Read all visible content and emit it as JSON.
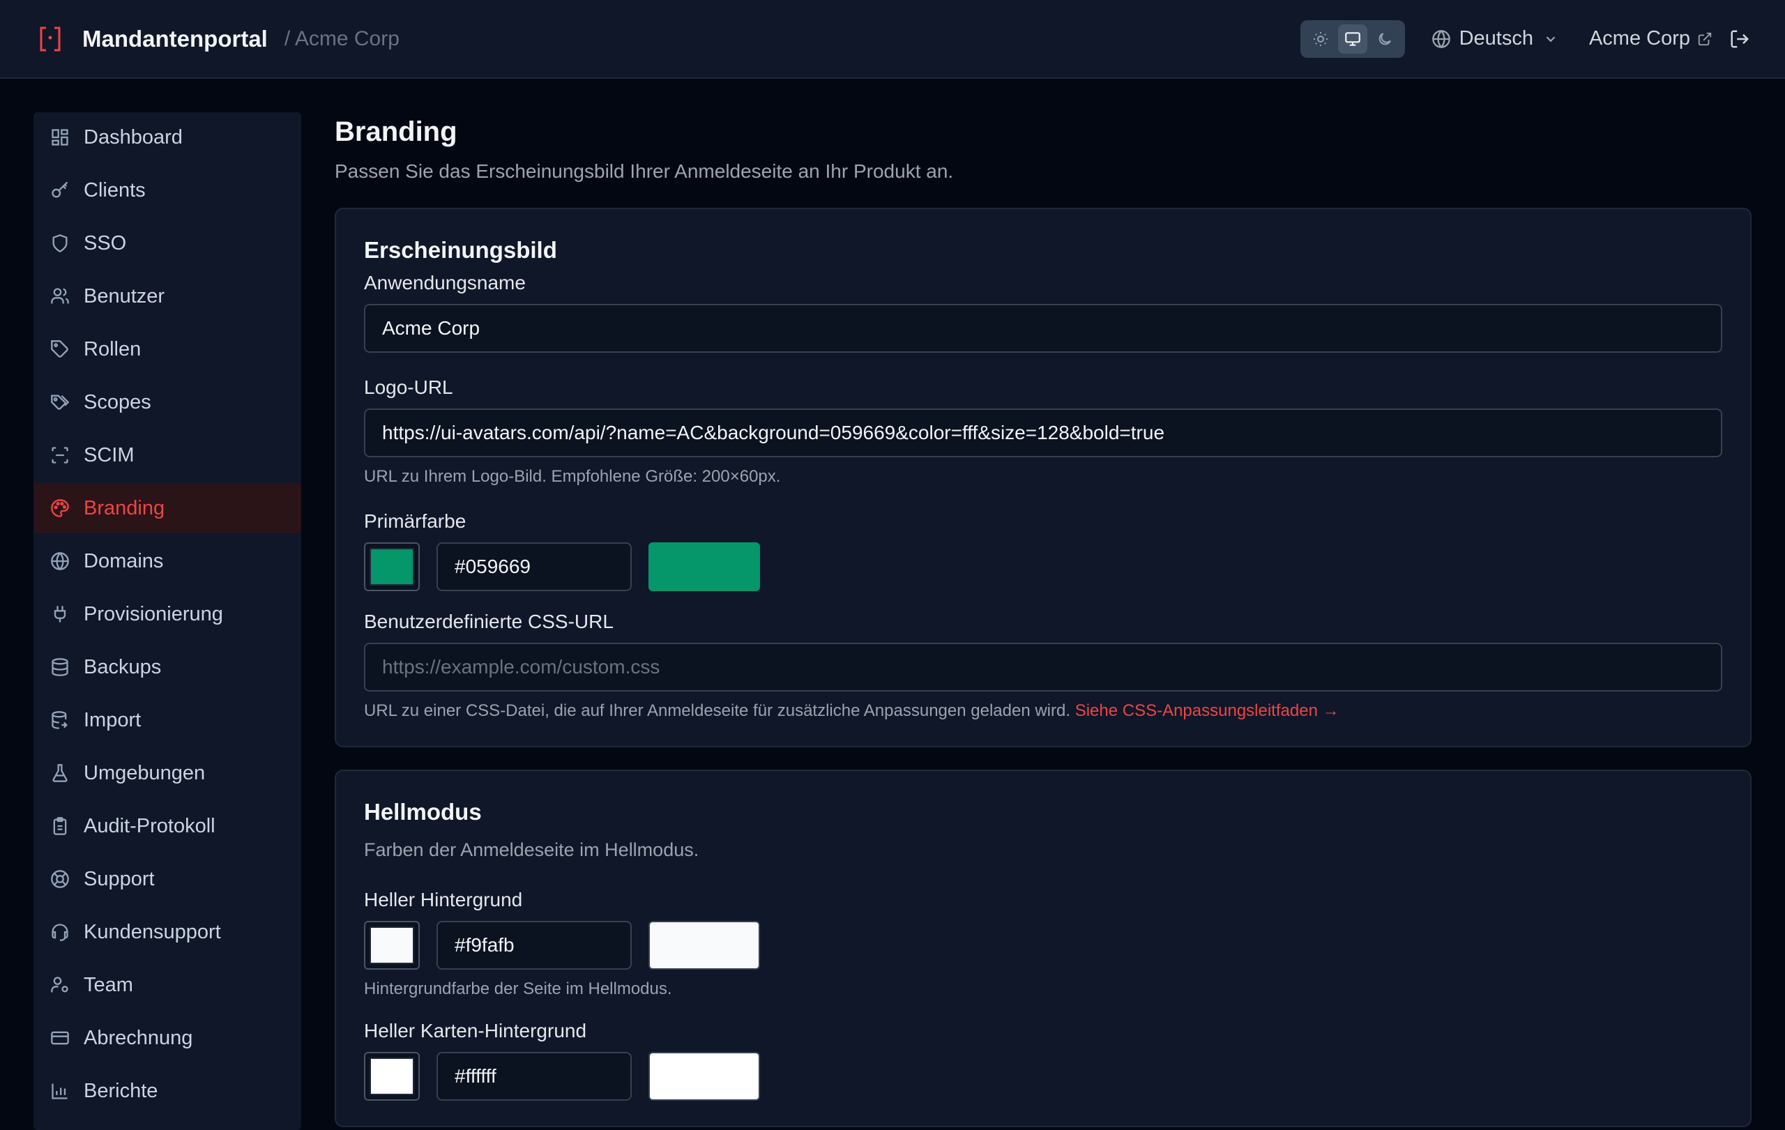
{
  "header": {
    "title": "Mandantenportal",
    "breadcrumb": "/ Acme Corp",
    "language": "Deutsch",
    "tenant": "Acme Corp",
    "brand_icon": "bracket-dot-icon"
  },
  "sidebar": {
    "items": [
      {
        "label": "Dashboard",
        "icon": "dashboard-icon"
      },
      {
        "label": "Clients",
        "icon": "key-icon"
      },
      {
        "label": "SSO",
        "icon": "shield-icon"
      },
      {
        "label": "Benutzer",
        "icon": "users-icon"
      },
      {
        "label": "Rollen",
        "icon": "tag-icon"
      },
      {
        "label": "Scopes",
        "icon": "tags-icon"
      },
      {
        "label": "SCIM",
        "icon": "scan-icon"
      },
      {
        "label": "Branding",
        "icon": "palette-icon",
        "active": true
      },
      {
        "label": "Domains",
        "icon": "globe-icon"
      },
      {
        "label": "Provisionierung",
        "icon": "plug-icon"
      },
      {
        "label": "Backups",
        "icon": "database-icon"
      },
      {
        "label": "Import",
        "icon": "database-import-icon"
      },
      {
        "label": "Umgebungen",
        "icon": "flask-icon"
      },
      {
        "label": "Audit-Protokoll",
        "icon": "clipboard-icon"
      },
      {
        "label": "Support",
        "icon": "lifebuoy-icon"
      },
      {
        "label": "Kundensupport",
        "icon": "headset-icon"
      },
      {
        "label": "Team",
        "icon": "user-gear-icon"
      },
      {
        "label": "Abrechnung",
        "icon": "credit-card-icon"
      },
      {
        "label": "Berichte",
        "icon": "bar-chart-icon"
      }
    ]
  },
  "main": {
    "title": "Branding",
    "subtitle": "Passen Sie das Erscheinungsbild Ihrer Anmeldeseite an Ihr Produkt an.",
    "appearance": {
      "title": "Erscheinungsbild",
      "app_name_label": "Anwendungsname",
      "app_name_value": "Acme Corp",
      "logo_label": "Logo-URL",
      "logo_value": "https://ui-avatars.com/api/?name=AC&background=059669&color=fff&size=128&bold=true",
      "logo_help": "URL zu Ihrem Logo-Bild. Empfohlene Größe: 200×60px.",
      "primary_label": "Primärfarbe",
      "primary_value": "#059669",
      "css_label": "Benutzerdefinierte CSS-URL",
      "css_placeholder": "https://example.com/custom.css",
      "css_help": "URL zu einer CSS-Datei, die auf Ihrer Anmeldeseite für zusätzliche Anpassungen geladen wird.",
      "css_link": "Siehe CSS-Anpassungsleitfaden →"
    },
    "light": {
      "title": "Hellmodus",
      "desc": "Farben der Anmeldeseite im Hellmodus.",
      "bg_label": "Heller Hintergrund",
      "bg_value": "#f9fafb",
      "bg_help": "Hintergrundfarbe der Seite im Hellmodus.",
      "card_label": "Heller Karten-Hintergrund",
      "card_value": "#ffffff"
    }
  },
  "colors": {
    "accent": "#ef4444",
    "primary": "#059669",
    "light_bg": "#f9fafb",
    "light_card": "#ffffff"
  }
}
